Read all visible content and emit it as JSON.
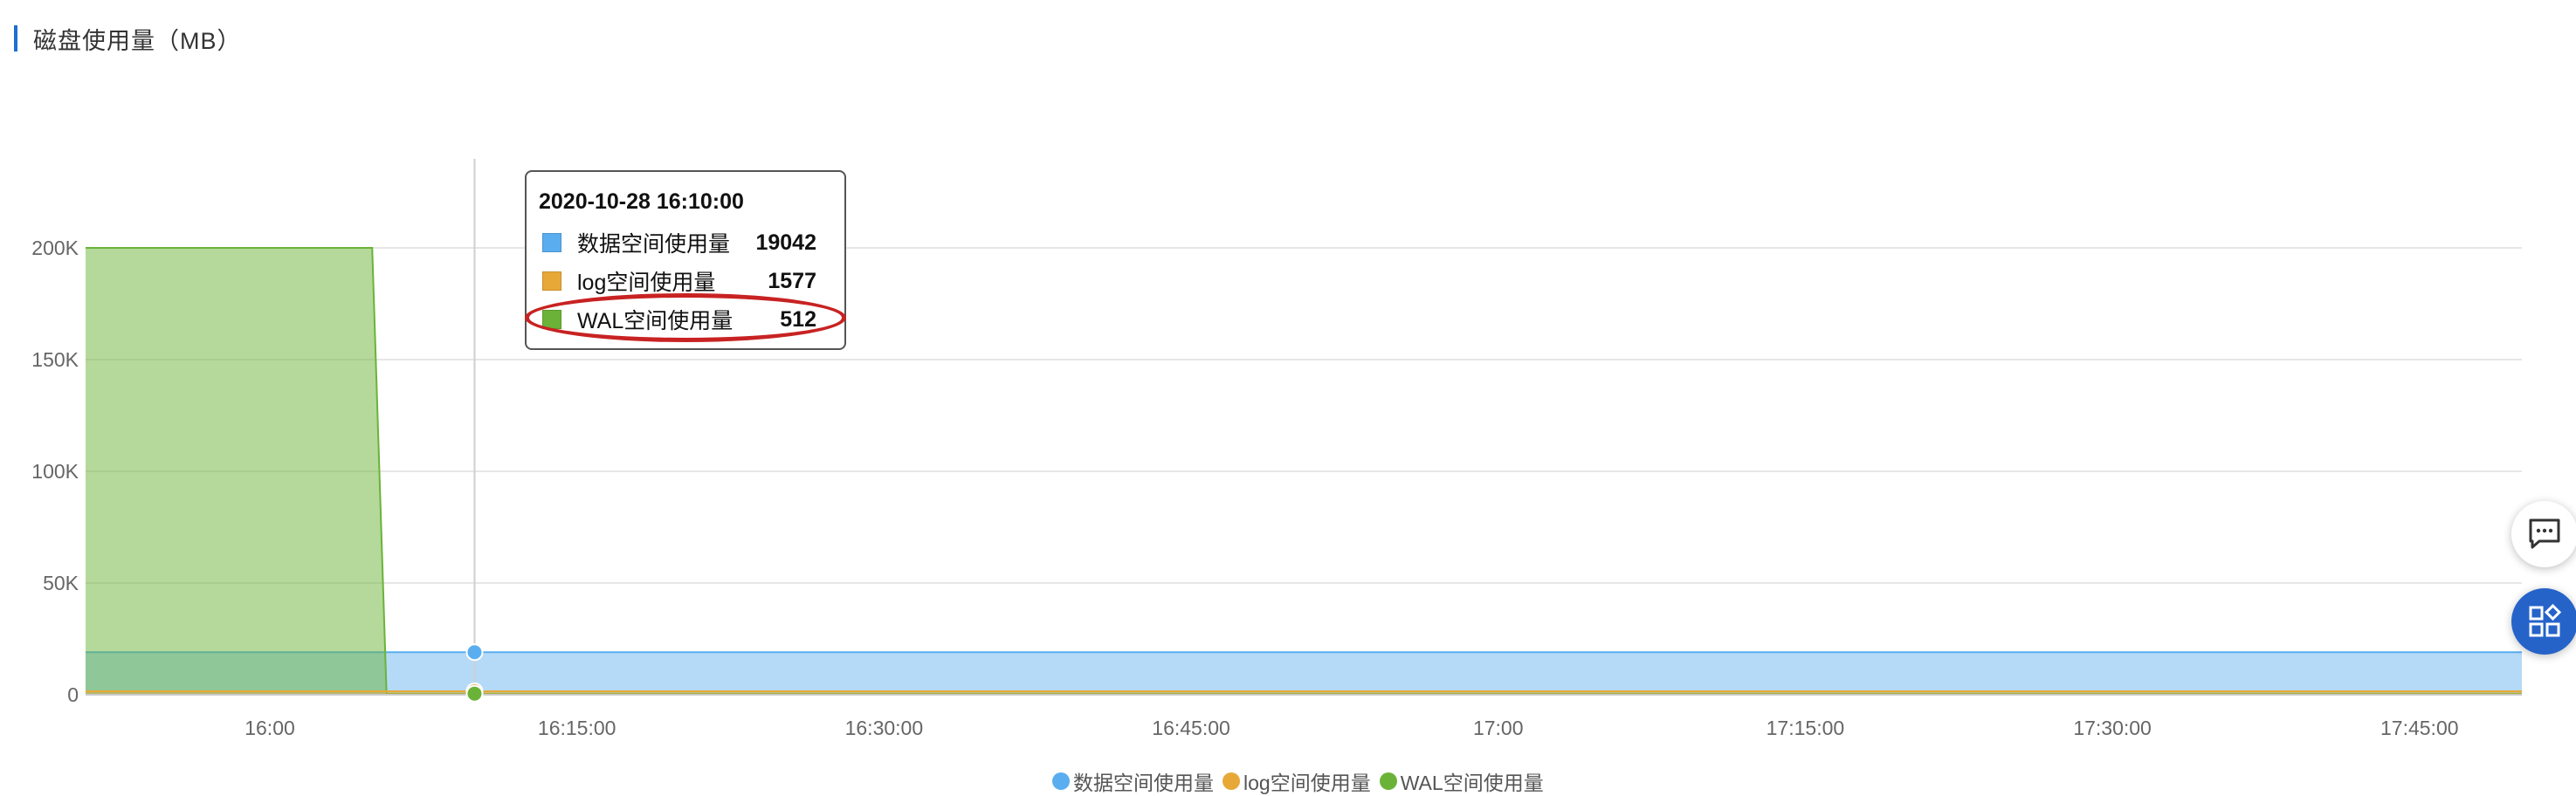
{
  "title": "磁盘使用量（MB）",
  "tooltip": {
    "time": "2020-10-28 16:10:00",
    "rows": [
      {
        "name": "数据空间使用量",
        "value": "19042",
        "color": "#5aaef0"
      },
      {
        "name": "log空间使用量",
        "value": "1577",
        "color": "#e8a838"
      },
      {
        "name": "WAL空间使用量",
        "value": "512",
        "color": "#6ab338"
      }
    ]
  },
  "legend": [
    {
      "name": "数据空间使用量",
      "color": "#5aaef0"
    },
    {
      "name": "log空间使用量",
      "color": "#e8a838"
    },
    {
      "name": "WAL空间使用量",
      "color": "#6ab338"
    }
  ],
  "side_buttons": {
    "chat_icon": "chat-icon",
    "apps_icon": "apps-icon"
  },
  "chart_data": {
    "type": "area",
    "title": "磁盘使用量（MB）",
    "x_ticks": [
      "16:00",
      "16:15:00",
      "16:30:00",
      "16:45:00",
      "17:00",
      "17:15:00",
      "17:30:00",
      "17:45:00"
    ],
    "y_ticks": [
      "0",
      "50K",
      "100K",
      "150K",
      "200K"
    ],
    "ylim": [
      0,
      200000
    ],
    "xlim_minutes": [
      -9,
      110
    ],
    "grid": true,
    "hover_minute": 10,
    "series": [
      {
        "name": "数据空间使用量",
        "color": "#5aaef0",
        "points": [
          [
            -9,
            19042
          ],
          [
            110,
            19042
          ]
        ]
      },
      {
        "name": "log空间使用量",
        "color": "#e8a838",
        "points": [
          [
            -9,
            1577
          ],
          [
            110,
            1577
          ]
        ]
      },
      {
        "name": "WAL空间使用量",
        "color": "#6ab338",
        "points": [
          [
            -9,
            200000
          ],
          [
            5,
            200000
          ],
          [
            5.7,
            512
          ],
          [
            110,
            512
          ]
        ]
      }
    ]
  }
}
